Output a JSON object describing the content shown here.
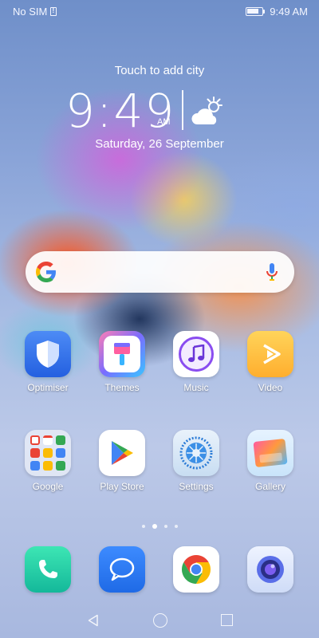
{
  "status_bar": {
    "carrier": "No SIM",
    "time": "9:49 AM"
  },
  "clock_widget": {
    "city_prompt": "Touch to add city",
    "time": "9:49",
    "ampm": "AM",
    "date": "Saturday, 26 September",
    "weather_icon": "partly-cloudy-icon"
  },
  "search": {
    "logo": "google-g-icon",
    "mic": "microphone-icon"
  },
  "apps": {
    "optimiser": "Optimiser",
    "themes": "Themes",
    "music": "Music",
    "video": "Video",
    "google": "Google",
    "play_store": "Play Store",
    "settings": "Settings",
    "gallery": "Gallery"
  },
  "dock": [
    "phone-icon",
    "messages-icon",
    "chrome-icon",
    "camera-icon"
  ],
  "page_indicator": {
    "pages": 4,
    "current": 2
  },
  "colors": {
    "google_blue": "#4285F4",
    "google_red": "#EA4335",
    "google_yellow": "#FBBC05",
    "google_green": "#34A853"
  }
}
